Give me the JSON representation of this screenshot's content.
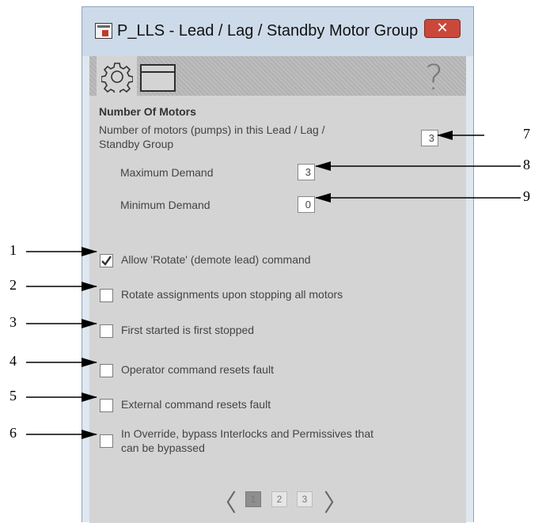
{
  "window": {
    "title": "P_LLS - Lead / Lag / Standby Motor Group",
    "close_label": "✕"
  },
  "tabs": [
    {
      "name": "configuration",
      "icon": "gear-icon"
    },
    {
      "name": "faceplate",
      "icon": "window-icon"
    }
  ],
  "help_label": "?",
  "motors": {
    "section_title": "Number Of Motors",
    "count_label_line1": "Number of motors (pumps) in this Lead / Lag /",
    "count_label_line2": "Standby Group",
    "count_value": "3",
    "max_demand_label": "Maximum Demand",
    "max_demand_value": "3",
    "min_demand_label": "Minimum Demand",
    "min_demand_value": "0"
  },
  "options": [
    {
      "label": "Allow 'Rotate' (demote lead) command",
      "checked": true
    },
    {
      "label": "Rotate assignments upon stopping all motors",
      "checked": false
    },
    {
      "label": "First started is first stopped",
      "checked": false
    },
    {
      "label": "Operator command resets fault",
      "checked": false
    },
    {
      "label": "External command resets fault",
      "checked": false
    },
    {
      "label_line1": "In Override, bypass Interlocks and Permissives that",
      "label_line2": "can be bypassed",
      "checked": false
    }
  ],
  "pager": {
    "prev": "〈",
    "next": "〉",
    "pages": [
      "1",
      "2",
      "3"
    ],
    "current_page": 1
  },
  "callouts": {
    "c1": "1",
    "c2": "2",
    "c3": "3",
    "c4": "4",
    "c5": "5",
    "c6": "6",
    "c7": "7",
    "c8": "8",
    "c9": "9"
  },
  "colors": {
    "window_frame": "#dfe7f0",
    "panel_bg": "#d4d4d4",
    "close_button": "#c9483a",
    "active_page": "#8e8e8e"
  }
}
